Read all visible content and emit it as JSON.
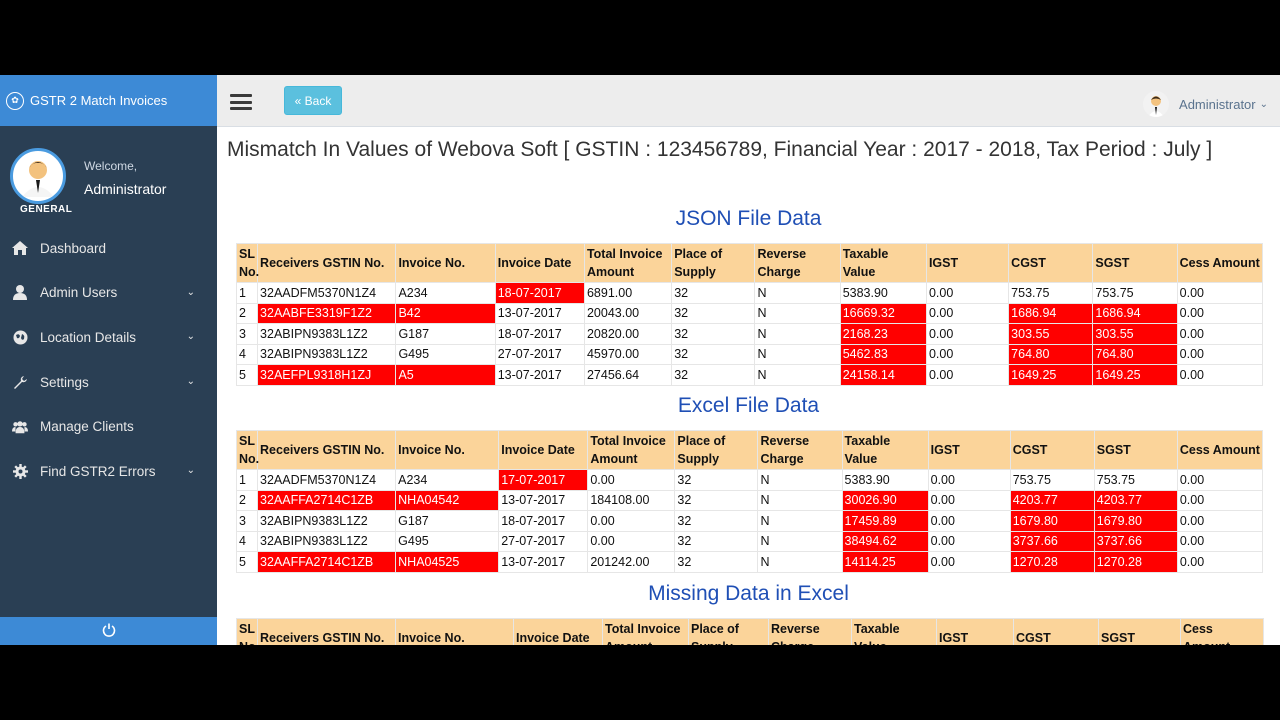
{
  "app": {
    "title": "GSTR 2 Match Invoices"
  },
  "profile": {
    "welcome": "Welcome,",
    "name": "Administrator",
    "section": "GENERAL"
  },
  "menu": [
    {
      "label": "Dashboard",
      "icon": "home-icon",
      "chevron": false
    },
    {
      "label": "Admin Users",
      "icon": "user-icon",
      "chevron": true
    },
    {
      "label": "Location Details",
      "icon": "globe-icon",
      "chevron": true
    },
    {
      "label": "Settings",
      "icon": "wrench-icon",
      "chevron": true
    },
    {
      "label": "Manage Clients",
      "icon": "users-icon",
      "chevron": false
    },
    {
      "label": "Find GSTR2 Errors",
      "icon": "gear-icon",
      "chevron": true
    }
  ],
  "topbar": {
    "back_label": "« Back",
    "user_label": "Administrator"
  },
  "page": {
    "title": "Mismatch In Values of Webova Soft [ GSTIN : 123456789, Financial Year : 2017 - 2018, Tax Period : July ]"
  },
  "headers": [
    "SL No.",
    "Receivers GSTIN No.",
    "Invoice No.",
    "Invoice Date",
    "Total Invoice Amount",
    "Place of Supply",
    "Reverse Charge",
    "Taxable Value",
    "IGST",
    "CGST",
    "SGST",
    "Cess Amount"
  ],
  "json_section": {
    "title": "JSON File Data",
    "rows": [
      [
        "1",
        "32AADFM5370N1Z4",
        "A234",
        "18-07-2017",
        "6891.00",
        "32",
        "N",
        "5383.90",
        "0.00",
        "753.75",
        "753.75",
        "0.00"
      ],
      [
        "2",
        "32AABFE3319F1Z2",
        "B42",
        "13-07-2017",
        "20043.00",
        "32",
        "N",
        "16669.32",
        "0.00",
        "1686.94",
        "1686.94",
        "0.00"
      ],
      [
        "3",
        "32ABIPN9383L1Z2",
        "G187",
        "18-07-2017",
        "20820.00",
        "32",
        "N",
        "2168.23",
        "0.00",
        "303.55",
        "303.55",
        "0.00"
      ],
      [
        "4",
        "32ABIPN9383L1Z2",
        "G495",
        "27-07-2017",
        "45970.00",
        "32",
        "N",
        "5462.83",
        "0.00",
        "764.80",
        "764.80",
        "0.00"
      ],
      [
        "5",
        "32AEFPL9318H1ZJ",
        "A5",
        "13-07-2017",
        "27456.64",
        "32",
        "N",
        "24158.14",
        "0.00",
        "1649.25",
        "1649.25",
        "0.00"
      ]
    ],
    "highlights": [
      [
        3
      ],
      [
        1,
        2,
        7,
        9,
        10
      ],
      [
        7,
        9,
        10
      ],
      [
        7,
        9,
        10
      ],
      [
        1,
        2,
        7,
        9,
        10
      ]
    ]
  },
  "excel_section": {
    "title": "Excel File Data",
    "rows": [
      [
        "1",
        "32AADFM5370N1Z4",
        "A234",
        "17-07-2017",
        "0.00",
        "32",
        "N",
        "5383.90",
        "0.00",
        "753.75",
        "753.75",
        "0.00"
      ],
      [
        "2",
        "32AAFFA2714C1ZB",
        "NHA04542",
        "13-07-2017",
        "184108.00",
        "32",
        "N",
        "30026.90",
        "0.00",
        "4203.77",
        "4203.77",
        "0.00"
      ],
      [
        "3",
        "32ABIPN9383L1Z2",
        "G187",
        "18-07-2017",
        "0.00",
        "32",
        "N",
        "17459.89",
        "0.00",
        "1679.80",
        "1679.80",
        "0.00"
      ],
      [
        "4",
        "32ABIPN9383L1Z2",
        "G495",
        "27-07-2017",
        "0.00",
        "32",
        "N",
        "38494.62",
        "0.00",
        "3737.66",
        "3737.66",
        "0.00"
      ],
      [
        "5",
        "32AAFFA2714C1ZB",
        "NHA04525",
        "13-07-2017",
        "201242.00",
        "32",
        "N",
        "14114.25",
        "0.00",
        "1270.28",
        "1270.28",
        "0.00"
      ]
    ],
    "highlights": [
      [
        3
      ],
      [
        1,
        2,
        7,
        9,
        10
      ],
      [
        7,
        9,
        10
      ],
      [
        7,
        9,
        10
      ],
      [
        1,
        2,
        7,
        9,
        10
      ]
    ]
  },
  "missing_section": {
    "title": "Missing Data in Excel"
  },
  "colors": {
    "sidebar": "#2a3f54",
    "accent": "#3d8ad6",
    "header_row": "#fbd49a",
    "mismatch": "#ff0000",
    "section_title": "#1f4fb5"
  }
}
